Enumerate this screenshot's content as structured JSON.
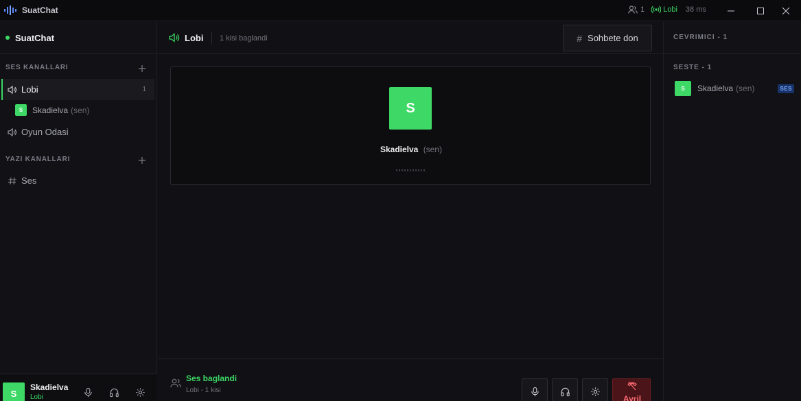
{
  "app": {
    "title": "SuatChat"
  },
  "titlebar": {
    "online_count": "1",
    "voice_channel": "Lobi",
    "ping": "38 ms"
  },
  "sidebar": {
    "server_name": "SuatChat",
    "voice_section": "SES KANALLARI",
    "text_section": "YAZI KANALLARI",
    "voice_channels": [
      {
        "name": "Lobi",
        "count": "1",
        "active": true
      },
      {
        "name": "Oyun Odasi"
      }
    ],
    "voice_member": {
      "initial": "S",
      "name": "Skadielva",
      "you_tag": "(sen)"
    },
    "text_channels": [
      {
        "name": "Ses"
      }
    ]
  },
  "userbar": {
    "initial": "S",
    "name": "Skadielva",
    "status": "Lobi"
  },
  "main": {
    "channel_title": "Lobi",
    "channel_subtitle": "1 kisi baglandi",
    "back_button": "Sohbete don",
    "participant": {
      "initial": "S",
      "name": "Skadielva",
      "you_tag": "(sen)"
    },
    "footer": {
      "status_title": "Ses baglandi",
      "status_sub": "Lobi - 1 kisi",
      "leave_label": "Ayril"
    }
  },
  "right": {
    "online_header": "CEVRIMICI - 1",
    "voice_header": "SESTE - 1",
    "member": {
      "initial": "S",
      "name": "Skadielva",
      "you_tag": "(sen)",
      "badge": "SES"
    }
  },
  "colors": {
    "accent": "#3dd865",
    "danger": "#ff6b74",
    "badge_bg": "#18336b"
  }
}
